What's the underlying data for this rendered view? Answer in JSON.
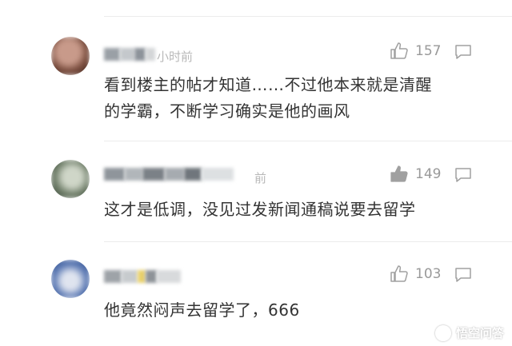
{
  "comments": [
    {
      "time": "小时前",
      "likes": "157",
      "text_lines": [
        "看到楼主的帖才知道……不过他本来就是清醒",
        "的学霸，不断学习确实是他的画风"
      ]
    },
    {
      "time": "前",
      "likes": "149",
      "text_lines": [
        "这才是低调，没见过发新闻通稿说要去留学"
      ]
    },
    {
      "time": "",
      "likes": "103",
      "text_lines": [
        "他竟然闷声去留学了，666"
      ]
    }
  ],
  "watermark": {
    "text": "悟空问答"
  },
  "icons": {
    "like": "thumbs-up-icon",
    "reply": "comment-bubble-icon"
  }
}
